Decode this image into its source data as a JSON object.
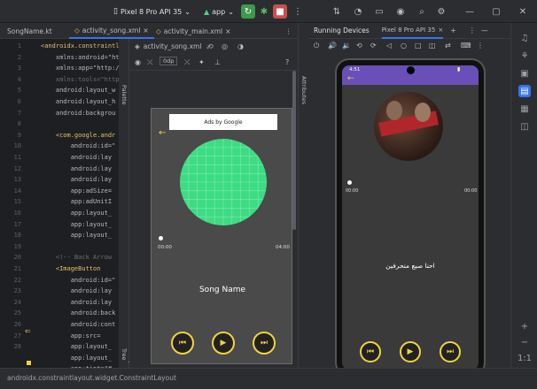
{
  "titlebar": {
    "device_label": "Pixel 8 Pro API 35",
    "config_label": "app"
  },
  "editor_tabs": [
    {
      "label": "SongName.kt",
      "active": false
    },
    {
      "label": "activity_song.xml",
      "active": true
    },
    {
      "label": "activity_main.xml",
      "active": false
    }
  ],
  "line_numbers": [
    "1",
    "2",
    "3",
    "4",
    "5",
    "6",
    "7",
    "8",
    "9",
    "10",
    "11",
    "12",
    "13",
    "14",
    "15",
    "16",
    "17",
    "18",
    "19",
    "20",
    "21",
    "22",
    "23",
    "24",
    "25",
    "26",
    "27",
    "28"
  ],
  "code_lines": [
    {
      "text": "<androidx.constraintl",
      "color": "#e8bf6a"
    },
    {
      "text": "    xmlns:android=\"ht",
      "color": "#bababa"
    },
    {
      "text": "    xmlns:app=\"http:/",
      "color": "#bababa"
    },
    {
      "text": "    xmlns:tools=\"http",
      "color": "#6b6e74"
    },
    {
      "text": "    android:layout_w",
      "color": "#bababa"
    },
    {
      "text": "    android:layout_h",
      "color": "#bababa"
    },
    {
      "text": "    android:backgrou",
      "color": "#bababa"
    },
    {
      "text": "",
      "color": "#bababa"
    },
    {
      "text": "    <com.google.andr",
      "color": "#e8bf6a"
    },
    {
      "text": "        android:id=\"",
      "color": "#bababa"
    },
    {
      "text": "        android:lay",
      "color": "#bababa"
    },
    {
      "text": "        android:lay",
      "color": "#bababa"
    },
    {
      "text": "        android:lay",
      "color": "#bababa"
    },
    {
      "text": "        app:adSize=",
      "color": "#bababa"
    },
    {
      "text": "        app:adUnitI",
      "color": "#bababa"
    },
    {
      "text": "        app:layout_",
      "color": "#bababa"
    },
    {
      "text": "        app:layout_",
      "color": "#bababa"
    },
    {
      "text": "        app:layout_",
      "color": "#bababa"
    },
    {
      "text": "",
      "color": "#bababa"
    },
    {
      "text": "    <!-- Back Arrow",
      "color": "#6b6e74"
    },
    {
      "text": "    <ImageButton",
      "color": "#e8bf6a"
    },
    {
      "text": "        android:id=\"",
      "color": "#bababa"
    },
    {
      "text": "        android:lay",
      "color": "#bababa"
    },
    {
      "text": "        android:lay",
      "color": "#bababa"
    },
    {
      "text": "        android:back",
      "color": "#bababa"
    },
    {
      "text": "        android:cont",
      "color": "#bababa"
    },
    {
      "text": "        app:src=",
      "color": "#bababa"
    },
    {
      "text": "        app:layout_",
      "color": "#bababa"
    },
    {
      "text": "        app:layout_",
      "color": "#bababa"
    },
    {
      "text": "        app:tint=\"#",
      "color": "#bababa"
    }
  ],
  "design": {
    "file_label": "activity_song.xml",
    "dp_label": "0dp",
    "left_strip_palette": "Palette",
    "left_strip_tree": "Component Tree",
    "attributes_strip": "Attributes"
  },
  "preview": {
    "ad_label": "Ads by Google",
    "time_start": "00:00",
    "time_end": "04:00",
    "song_name": "Song Name",
    "art_color": "#3ddc84"
  },
  "running_devices": {
    "title": "Running Devices",
    "device_tab": "Pixel 8 Pro API 35"
  },
  "phone": {
    "status_time": "4:51",
    "time_start": "00:00",
    "time_end": "00:00",
    "song_title": "احنا صيع منحرفين"
  },
  "statusbar": {
    "path": "androidx.constraintlayout.widget.ConstraintLayout"
  },
  "colors": {
    "accent": "#3574f0",
    "player_button": "#f2d33c",
    "run_green": "#3e9a4b",
    "stop_red": "#c94f4f",
    "phone_topbar": "#6a4fb8"
  }
}
